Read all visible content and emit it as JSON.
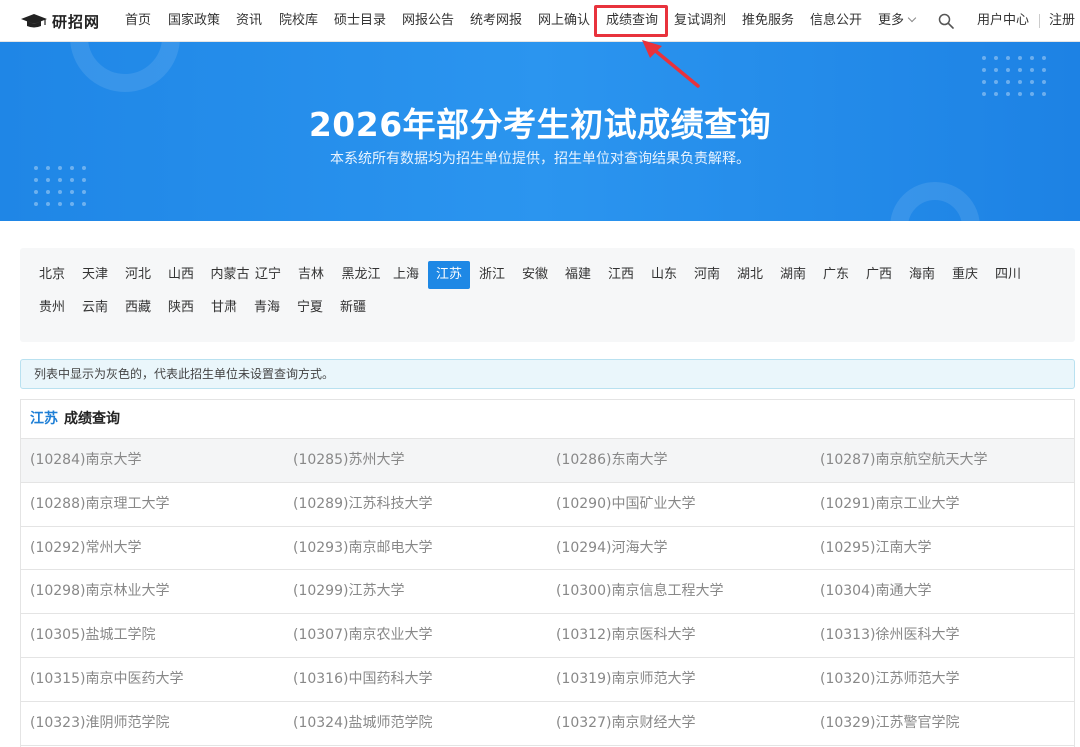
{
  "brand": {
    "name": "研招网"
  },
  "nav": {
    "items": [
      "首页",
      "国家政策",
      "资讯",
      "院校库",
      "硕士目录",
      "网报公告",
      "统考网报",
      "网上确认",
      "成绩查询",
      "复试调剂",
      "推免服务",
      "信息公开",
      "更多"
    ],
    "active_index": 8,
    "user_center": "用户中心",
    "register": "注册"
  },
  "banner": {
    "title": "2026年部分考生初试成绩查询",
    "subtitle": "本系统所有数据均为招生单位提供，招生单位对查询结果负责解释。"
  },
  "provinces": {
    "items": [
      "北京",
      "天津",
      "河北",
      "山西",
      "内蒙古",
      "辽宁",
      "吉林",
      "黑龙江",
      "上海",
      "江苏",
      "浙江",
      "安徽",
      "福建",
      "江西",
      "山东",
      "河南",
      "湖北",
      "湖南",
      "广东",
      "广西",
      "海南",
      "重庆",
      "四川",
      "贵州",
      "云南",
      "西藏",
      "陕西",
      "甘肃",
      "青海",
      "宁夏",
      "新疆"
    ],
    "active": "江苏"
  },
  "notice": "列表中显示为灰色的，代表此招生单位未设置查询方式。",
  "panel": {
    "province": "江苏",
    "heading": "成绩查询",
    "schools": [
      [
        "(10284)南京大学",
        "(10285)苏州大学",
        "(10286)东南大学",
        "(10287)南京航空航天大学"
      ],
      [
        "(10288)南京理工大学",
        "(10289)江苏科技大学",
        "(10290)中国矿业大学",
        "(10291)南京工业大学"
      ],
      [
        "(10292)常州大学",
        "(10293)南京邮电大学",
        "(10294)河海大学",
        "(10295)江南大学"
      ],
      [
        "(10298)南京林业大学",
        "(10299)江苏大学",
        "(10300)南京信息工程大学",
        "(10304)南通大学"
      ],
      [
        "(10305)盐城工学院",
        "(10307)南京农业大学",
        "(10312)南京医科大学",
        "(10313)徐州医科大学"
      ],
      [
        "(10315)南京中医药大学",
        "(10316)中国药科大学",
        "(10319)南京师范大学",
        "(10320)江苏师范大学"
      ],
      [
        "(10323)淮阴师范学院",
        "(10324)盐城师范学院",
        "(10327)南京财经大学",
        "(10329)江苏警官学院"
      ]
    ]
  },
  "colors": {
    "accent": "#1e88e5",
    "highlight": "#e8323c",
    "banner": "#2b95ef"
  }
}
